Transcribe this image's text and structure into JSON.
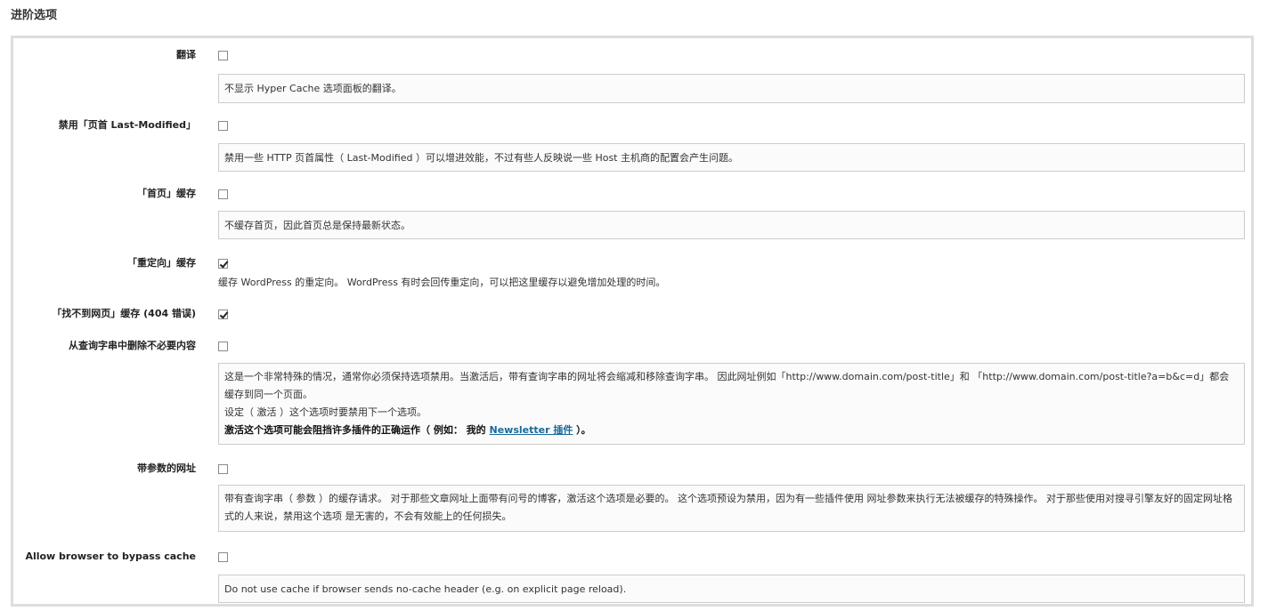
{
  "page": {
    "title": "进阶选项"
  },
  "options": [
    {
      "label": "翻译",
      "checked": false,
      "desc": "不显示 Hyper Cache 选项面板的翻译。"
    },
    {
      "label": "禁用「页首 Last-Modified」",
      "checked": false,
      "desc": "禁用一些 HTTP 页首属性（ Last-Modified ）可以增进效能，不过有些人反映说一些 Host 主机商的配置会产生问题。"
    },
    {
      "label": "「首页」缓存",
      "checked": false,
      "desc": "不缓存首页，因此首页总是保持最新状态。"
    },
    {
      "label": "「重定向」缓存",
      "checked": true,
      "desc": "缓存 WordPress 的重定向。 WordPress 有时会回传重定向，可以把这里缓存以避免增加处理的时间。"
    },
    {
      "label": "「找不到网页」缓存 (404 错误)",
      "checked": true
    },
    {
      "label": "从查询字串中删除不必要内容",
      "checked": false,
      "desc_line1": "这是一个非常特殊的情况，通常你必须保持选项禁用。当激活后，带有查询字串的网址将会缩减和移除查询字串。 因此网址例如「http://www.domain.com/post-title」和 「http://www.domain.com/post-title?a=b&c=d」都会缓存到同一个页面。",
      "desc_line2": "设定（ 激活 ）这个选项时要禁用下一个选项。",
      "warning_prefix": "激活这个选项可能会阻挡许多插件的正确运作（ 例如： 我的 ",
      "warning_link": "Newsletter 插件",
      "warning_suffix": " ）。"
    },
    {
      "label": "带参数的网址",
      "checked": false,
      "desc": "带有查询字串（ 参数 ）的缓存请求。 对于那些文章网址上面带有问号的博客，激活这个选项是必要的。 这个选项预设为禁用，因为有一些插件使用 网址参数来执行无法被缓存的特殊操作。 对于那些使用对搜寻引擎友好的固定网址格式的人来说，禁用这个选项 是无害的，不会有效能上的任何损失。"
    },
    {
      "label": "Allow browser to bypass cache",
      "checked": false,
      "desc": "Do not use cache if browser sends no-cache header (e.g. on explicit page reload)."
    }
  ]
}
